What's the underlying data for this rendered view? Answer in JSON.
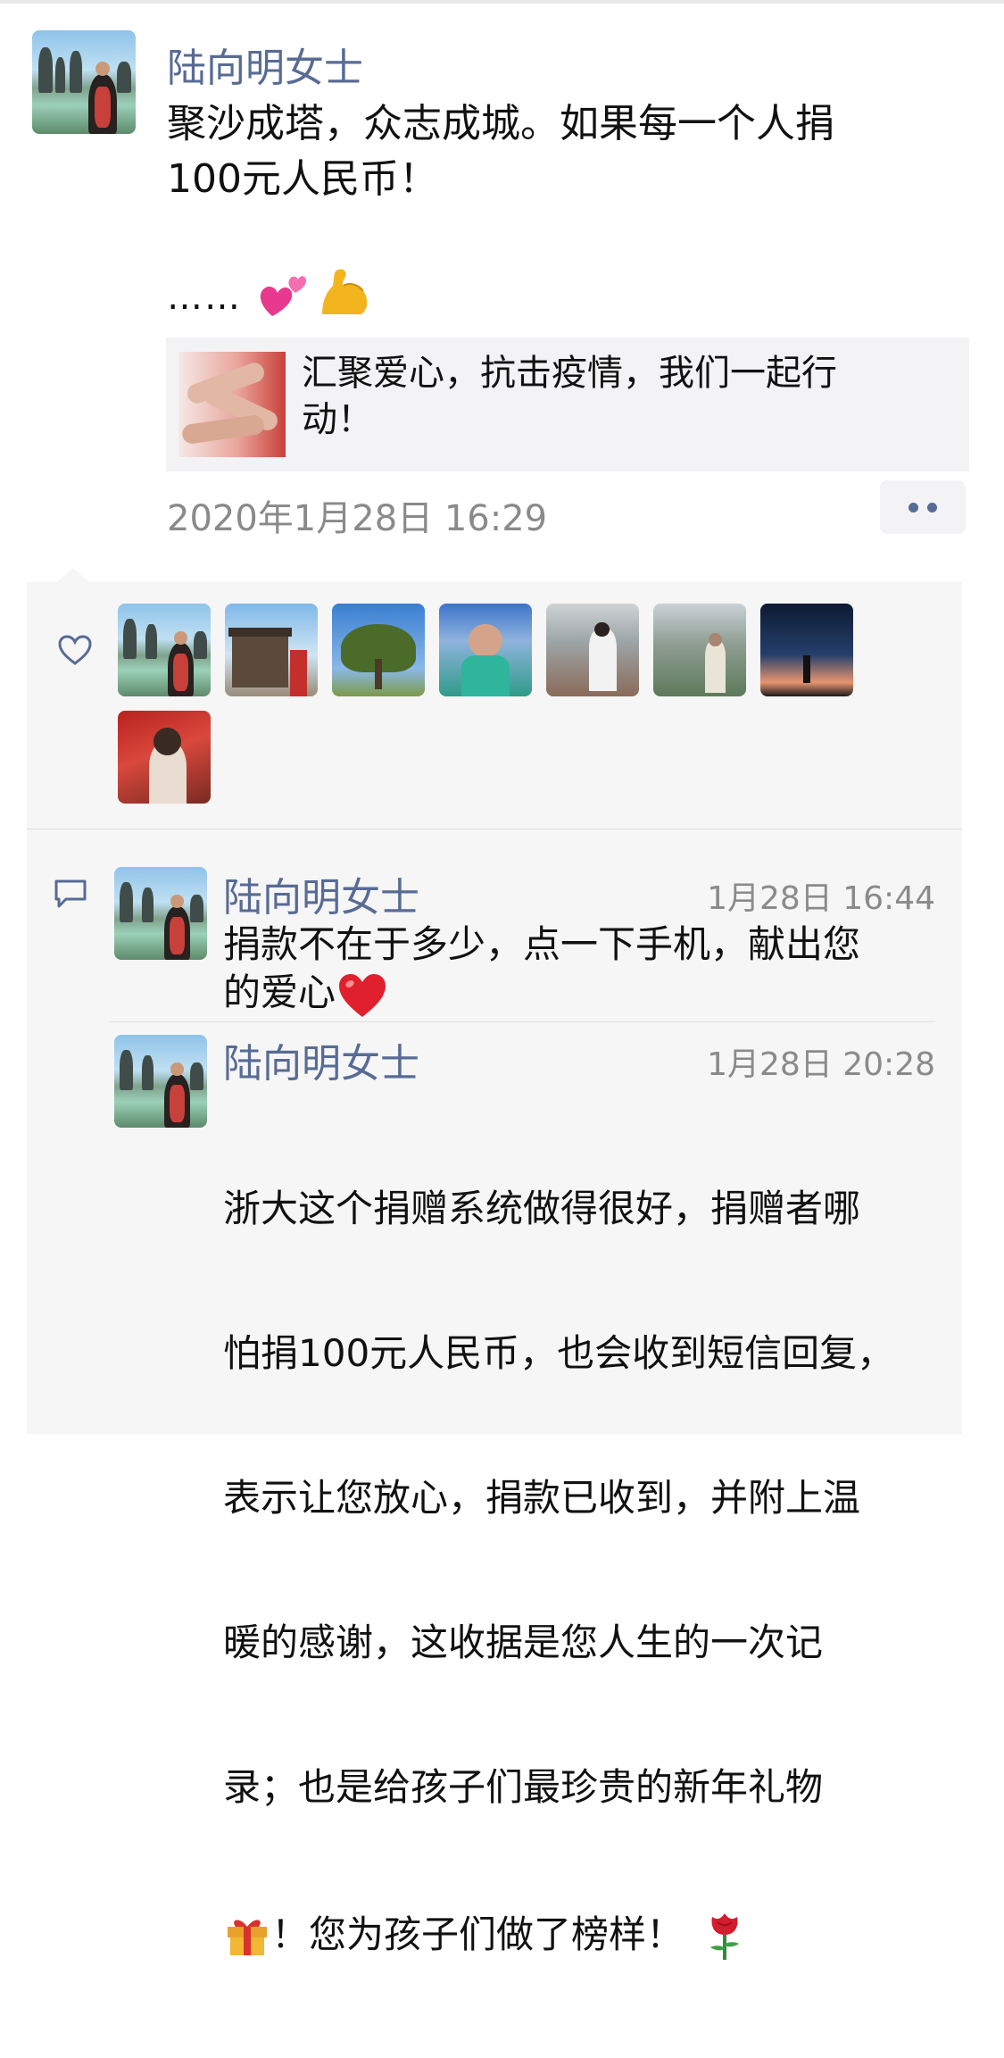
{
  "post": {
    "author": "陆向明女士",
    "text": "聚沙成塔，众志成城。如果每一个人捐\n100元人民币！",
    "dots": "……",
    "emojis": [
      "two-hearts",
      "flexed-biceps"
    ],
    "link": {
      "title": "汇聚爱心，抗击疫情，我们一起行动！"
    },
    "timestamp": "2020年1月28日 16:29"
  },
  "likes": {
    "count_avatars": 8
  },
  "comments": [
    {
      "author": "陆向明女士",
      "time": "1月28日 16:44",
      "text": "捐款不在于多少，点一下手机，献出您\n的爱心"
    },
    {
      "author": "陆向明女士",
      "time": "1月28日 20:28",
      "text_lines": [
        "浙大这个捐赠系统做得很好，捐赠者哪",
        "怕捐100元人民币，也会收到短信回复，",
        "表示让您放心，捐款已收到，并附上温",
        "暖的感谢，这收据是您人生的一次记",
        "录；也是给孩子们最珍贵的新年礼物",
        "！您为孩子们做了榜样！"
      ]
    }
  ],
  "colors": {
    "name_blue": "#576b95",
    "time_gray": "#8a8a8a",
    "panel_bg": "#f6f6f6"
  }
}
